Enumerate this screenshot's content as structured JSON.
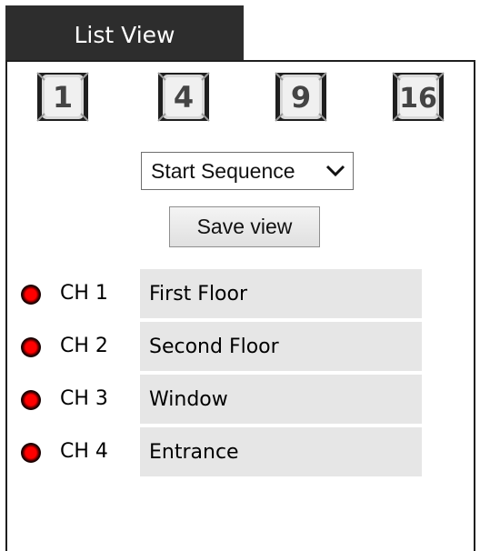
{
  "tab": {
    "label": "List View"
  },
  "layouts": [
    {
      "label": "1",
      "icon": "single-view-icon"
    },
    {
      "label": "4",
      "icon": "quad-view-icon"
    },
    {
      "label": "9",
      "icon": "nine-view-icon"
    },
    {
      "label": "16",
      "icon": "sixteen-view-icon"
    }
  ],
  "sequence": {
    "selected": "Start Sequence"
  },
  "save_view": {
    "label": "Save view"
  },
  "channels": [
    {
      "channel": "CH 1",
      "name": "First Floor",
      "status_color": "#ff0000"
    },
    {
      "channel": "CH 2",
      "name": "Second Floor",
      "status_color": "#ff0000"
    },
    {
      "channel": "CH 3",
      "name": "Window",
      "status_color": "#ff0000"
    },
    {
      "channel": "CH 4",
      "name": "Entrance",
      "status_color": "#ff0000"
    }
  ]
}
